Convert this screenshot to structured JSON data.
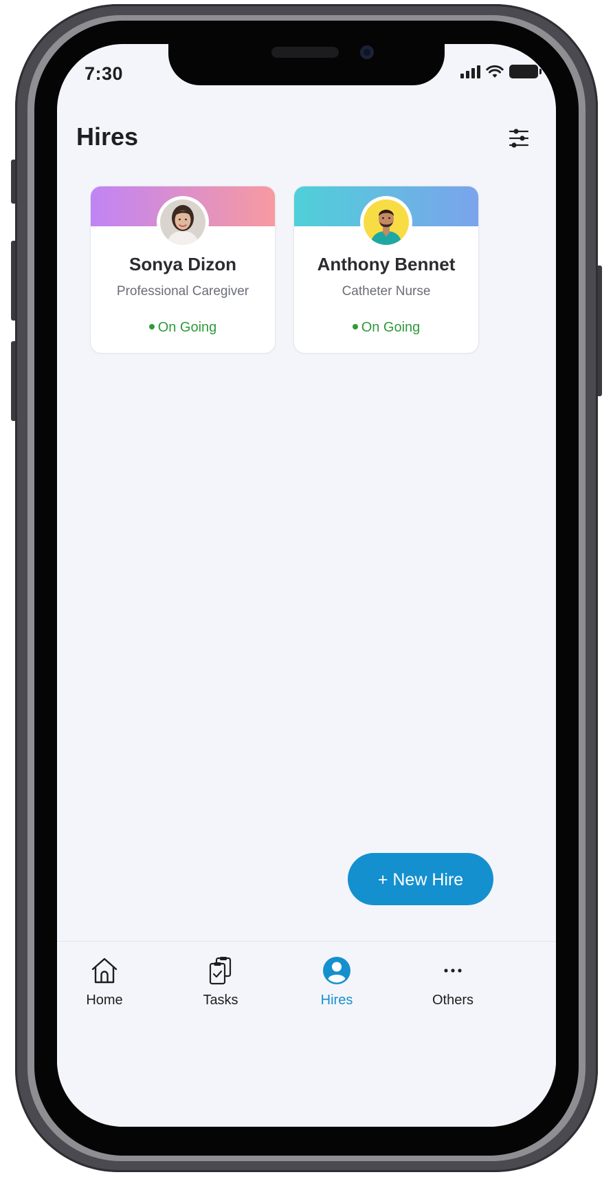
{
  "status_bar": {
    "time": "7:30"
  },
  "header": {
    "title": "Hires"
  },
  "hires": [
    {
      "name": "Sonya Dizon",
      "role": "Professional Caregiver",
      "status": "On Going",
      "banner_colors": [
        "#c084f5",
        "#f79aa0"
      ],
      "avatar_bg": "#d9d4ce"
    },
    {
      "name": "Anthony Bennet",
      "role": "Catheter Nurse",
      "status": "On Going",
      "banner_colors": [
        "#4fd0d8",
        "#7ba3ec"
      ],
      "avatar_bg": "#f8dc43"
    }
  ],
  "fab": {
    "label": "+ New Hire"
  },
  "nav": {
    "items": [
      {
        "label": "Home",
        "icon": "home-icon"
      },
      {
        "label": "Tasks",
        "icon": "tasks-icon"
      },
      {
        "label": "Hires",
        "icon": "user-circle-icon",
        "active": true
      },
      {
        "label": "Others",
        "icon": "more-icon"
      }
    ]
  },
  "colors": {
    "accent": "#1590cf",
    "status_green": "#2f9a3a",
    "background": "#f4f5fa"
  }
}
